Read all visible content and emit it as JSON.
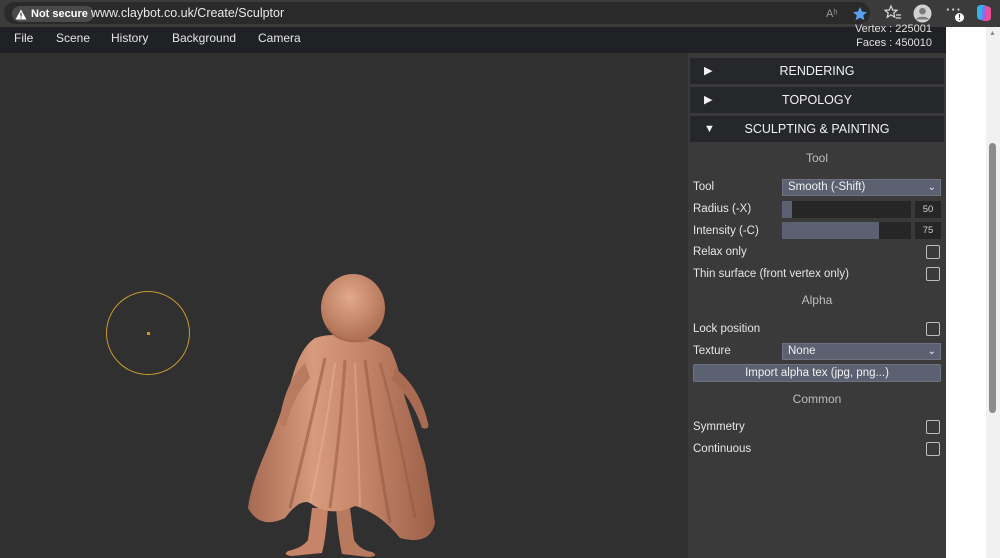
{
  "browser": {
    "security_label": "Not secure",
    "url": "www.claybot.co.uk/Create/Sculptor",
    "read_aloud_glyph": "Aʰ",
    "more_glyph": "···"
  },
  "menu": {
    "items": [
      {
        "label": "File"
      },
      {
        "label": "Scene"
      },
      {
        "label": "History"
      },
      {
        "label": "Background"
      },
      {
        "label": "Camera"
      }
    ],
    "vertex_text": "Vertex : 225001",
    "faces_text": "Faces : 450010"
  },
  "panel": {
    "rendering": {
      "arrow": "▶",
      "label": "RENDERING"
    },
    "topology": {
      "arrow": "▶",
      "label": "TOPOLOGY"
    },
    "sculpting": {
      "arrow": "▼",
      "label": "SCULPTING & PAINTING"
    },
    "tool_section": "Tool",
    "tool": {
      "label": "Tool",
      "value": "Smooth (-Shift)"
    },
    "radius": {
      "label": "Radius (-X)",
      "value": "50",
      "fraction": 0.08
    },
    "intensity": {
      "label": "Intensity (-C)",
      "value": "75",
      "fraction": 0.75
    },
    "relax_only": {
      "label": "Relax only",
      "checked": false
    },
    "thin_surface": {
      "label": "Thin surface (front vertex only)",
      "checked": false
    },
    "alpha_section": "Alpha",
    "lock_position": {
      "label": "Lock position",
      "checked": false
    },
    "texture": {
      "label": "Texture",
      "value": "None"
    },
    "import_alpha": {
      "label": "Import alpha tex (jpg, png...)"
    },
    "common_section": "Common",
    "symmetry": {
      "label": "Symmetry",
      "checked": false
    },
    "continuous": {
      "label": "Continuous",
      "checked": false
    }
  },
  "colors": {
    "model": "#c98a6c",
    "brush_ring": "#c99a2e",
    "panel_bg": "#3a3a3a",
    "header_bg": "#25272a",
    "accent": "#5b6170"
  }
}
